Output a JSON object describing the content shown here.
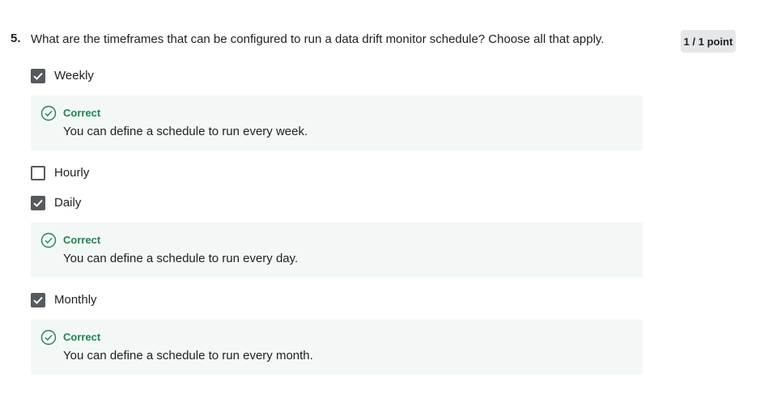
{
  "question": {
    "number": "5.",
    "text": "What are the timeframes that can be configured to run a data drift monitor schedule? Choose all that apply.",
    "score": "1 / 1 point"
  },
  "options": [
    {
      "label": "Weekly",
      "checked": true,
      "feedback": {
        "title": "Correct",
        "text": "You can define a schedule to run every week."
      }
    },
    {
      "label": "Hourly",
      "checked": false
    },
    {
      "label": "Daily",
      "checked": true,
      "feedback": {
        "title": "Correct",
        "text": "You can define a schedule to run every day."
      }
    },
    {
      "label": "Monthly",
      "checked": true,
      "feedback": {
        "title": "Correct",
        "text": "You can define a schedule to run every month."
      }
    }
  ],
  "colors": {
    "correct": "#1f8354",
    "feedback_bg": "#f3f8f6",
    "checkbox": "#555a5f"
  }
}
